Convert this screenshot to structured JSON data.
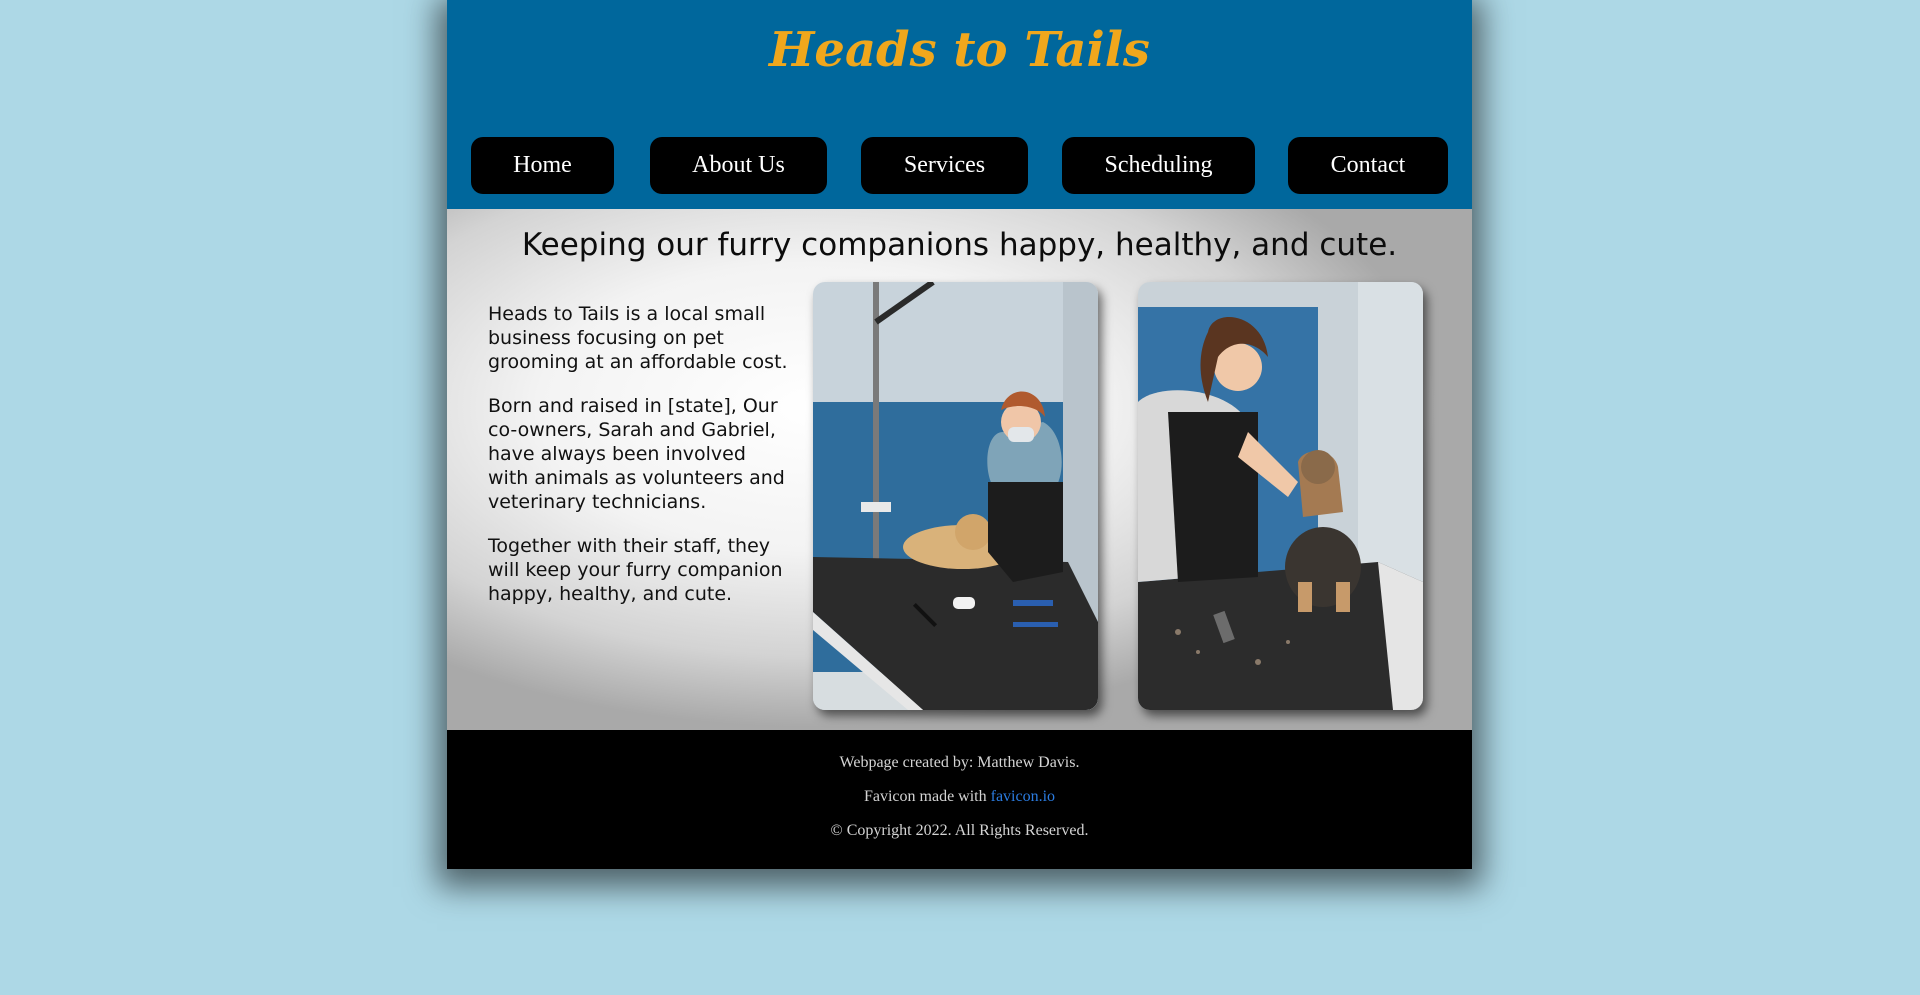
{
  "header": {
    "title": "Heads to Tails"
  },
  "nav": {
    "items": [
      {
        "label": "Home"
      },
      {
        "label": "About Us"
      },
      {
        "label": "Services"
      },
      {
        "label": "Scheduling"
      },
      {
        "label": "Contact"
      }
    ]
  },
  "main": {
    "tagline": "Keeping our furry companions happy, healthy, and cute.",
    "paragraphs": [
      "Heads to Tails is a local small business focusing on pet grooming at an affordable cost.",
      "Born and raised in [state], Our co-owners, Sarah and Gabriel, have always been involved with animals as volunteers and veterinary technicians.",
      "Together with their staff, they will keep your furry companion happy, healthy, and cute."
    ]
  },
  "footer": {
    "created_by": "Webpage created by: Matthew Davis.",
    "favicon_prefix": "Favicon made with ",
    "favicon_link": "favicon.io",
    "copyright": "© Copyright 2022. All Rights Reserved."
  },
  "colors": {
    "background": "#add8e6",
    "header": "#00679c",
    "title": "#f0a71c",
    "nav_button": "#000000",
    "footer": "#000000",
    "link": "#2b7ce0"
  }
}
